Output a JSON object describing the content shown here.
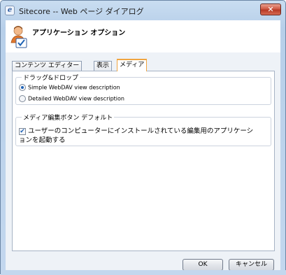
{
  "window": {
    "title": "Sitecore -- Web ページ ダイアログ",
    "app_icon_glyph": "e",
    "close_glyph": "✕"
  },
  "header": {
    "title": "アプリケーション オプション",
    "icon": "user-settings-icon"
  },
  "tabs": [
    {
      "label": "コンテンツ エディター",
      "active": false
    },
    {
      "label": "表示",
      "active": false
    },
    {
      "label": "メディア",
      "active": true
    }
  ],
  "drag_drop": {
    "legend": "ドラッグ&ドロップ",
    "options": [
      {
        "label": "Simple WebDAV view description",
        "checked": true
      },
      {
        "label": "Detailed WebDAV view description",
        "checked": false
      }
    ]
  },
  "media_edit": {
    "legend": "メディア編集ボタン デフォルト",
    "checkbox": {
      "checked": true,
      "label_line1": "ユーザーのコンピューターにインストールされている編集用のアプリケーシ",
      "label_line2": "ョンを起動する"
    }
  },
  "buttons": {
    "ok": "OK",
    "cancel": "キャンセル"
  },
  "colors": {
    "active_tab_accent": "#f0a541",
    "title_bar": "#c3d7ee",
    "close_button": "#c94a36"
  }
}
